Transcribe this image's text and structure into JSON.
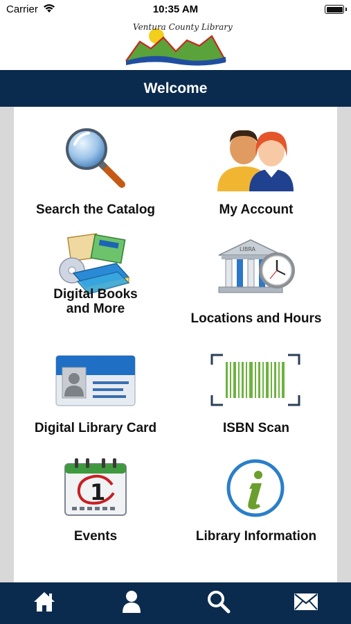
{
  "status_bar": {
    "carrier": "Carrier",
    "time": "10:35 AM"
  },
  "logo": {
    "text": "Ventura County Library"
  },
  "header": {
    "title": "Welcome"
  },
  "menu": {
    "items": [
      {
        "label": "Search the Catalog",
        "icon": "magnifier-icon"
      },
      {
        "label": "My Account",
        "icon": "people-icon"
      },
      {
        "label_line1": "Digital Books",
        "label_line2": "and More",
        "icon": "digital-media-icon"
      },
      {
        "label": "Locations and Hours",
        "icon": "library-clock-icon"
      },
      {
        "label": "Digital Library Card",
        "icon": "id-card-icon"
      },
      {
        "label": "ISBN Scan",
        "icon": "barcode-icon"
      },
      {
        "label": "Events",
        "icon": "calendar-icon"
      },
      {
        "label": "Library Information",
        "icon": "info-icon"
      }
    ]
  },
  "tab_bar": {
    "tabs": [
      "home-icon",
      "account-icon",
      "search-icon",
      "mail-icon"
    ]
  },
  "colors": {
    "navy": "#0b2b4e",
    "panel_bg": "#ffffff",
    "frame_bg": "#d8d8d8"
  }
}
